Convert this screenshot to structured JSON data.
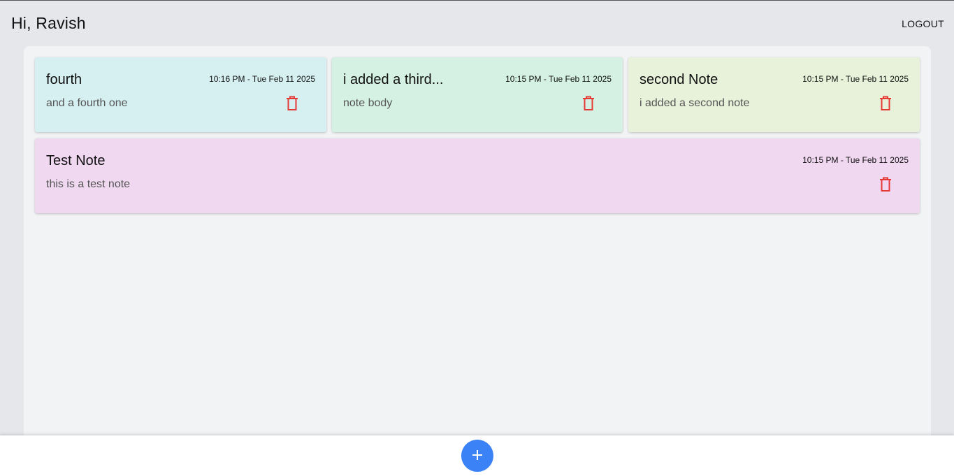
{
  "header": {
    "greeting": "Hi, Ravish",
    "logout_label": "LOGOUT"
  },
  "notes": [
    {
      "title": "fourth",
      "timestamp": "10:16 PM - Tue Feb 11 2025",
      "body": "and a fourth one",
      "color": "#d6f0f2"
    },
    {
      "title": "i added a third...",
      "timestamp": "10:15 PM - Tue Feb 11 2025",
      "body": "note body",
      "color": "#d5f1e4"
    },
    {
      "title": "second Note",
      "timestamp": "10:15 PM - Tue Feb 11 2025",
      "body": "i added a second note",
      "color": "#e8f1d9"
    },
    {
      "title": "Test Note",
      "timestamp": "10:15 PM - Tue Feb 11 2025",
      "body": "this is a test note",
      "color": "#f1d8f1"
    }
  ],
  "icons": {
    "delete": "trash-icon",
    "add": "plus-icon"
  },
  "colors": {
    "accent": "#3b82f6",
    "delete": "#e53935",
    "background": "#e5e7eb",
    "board": "#f2f3f5"
  }
}
